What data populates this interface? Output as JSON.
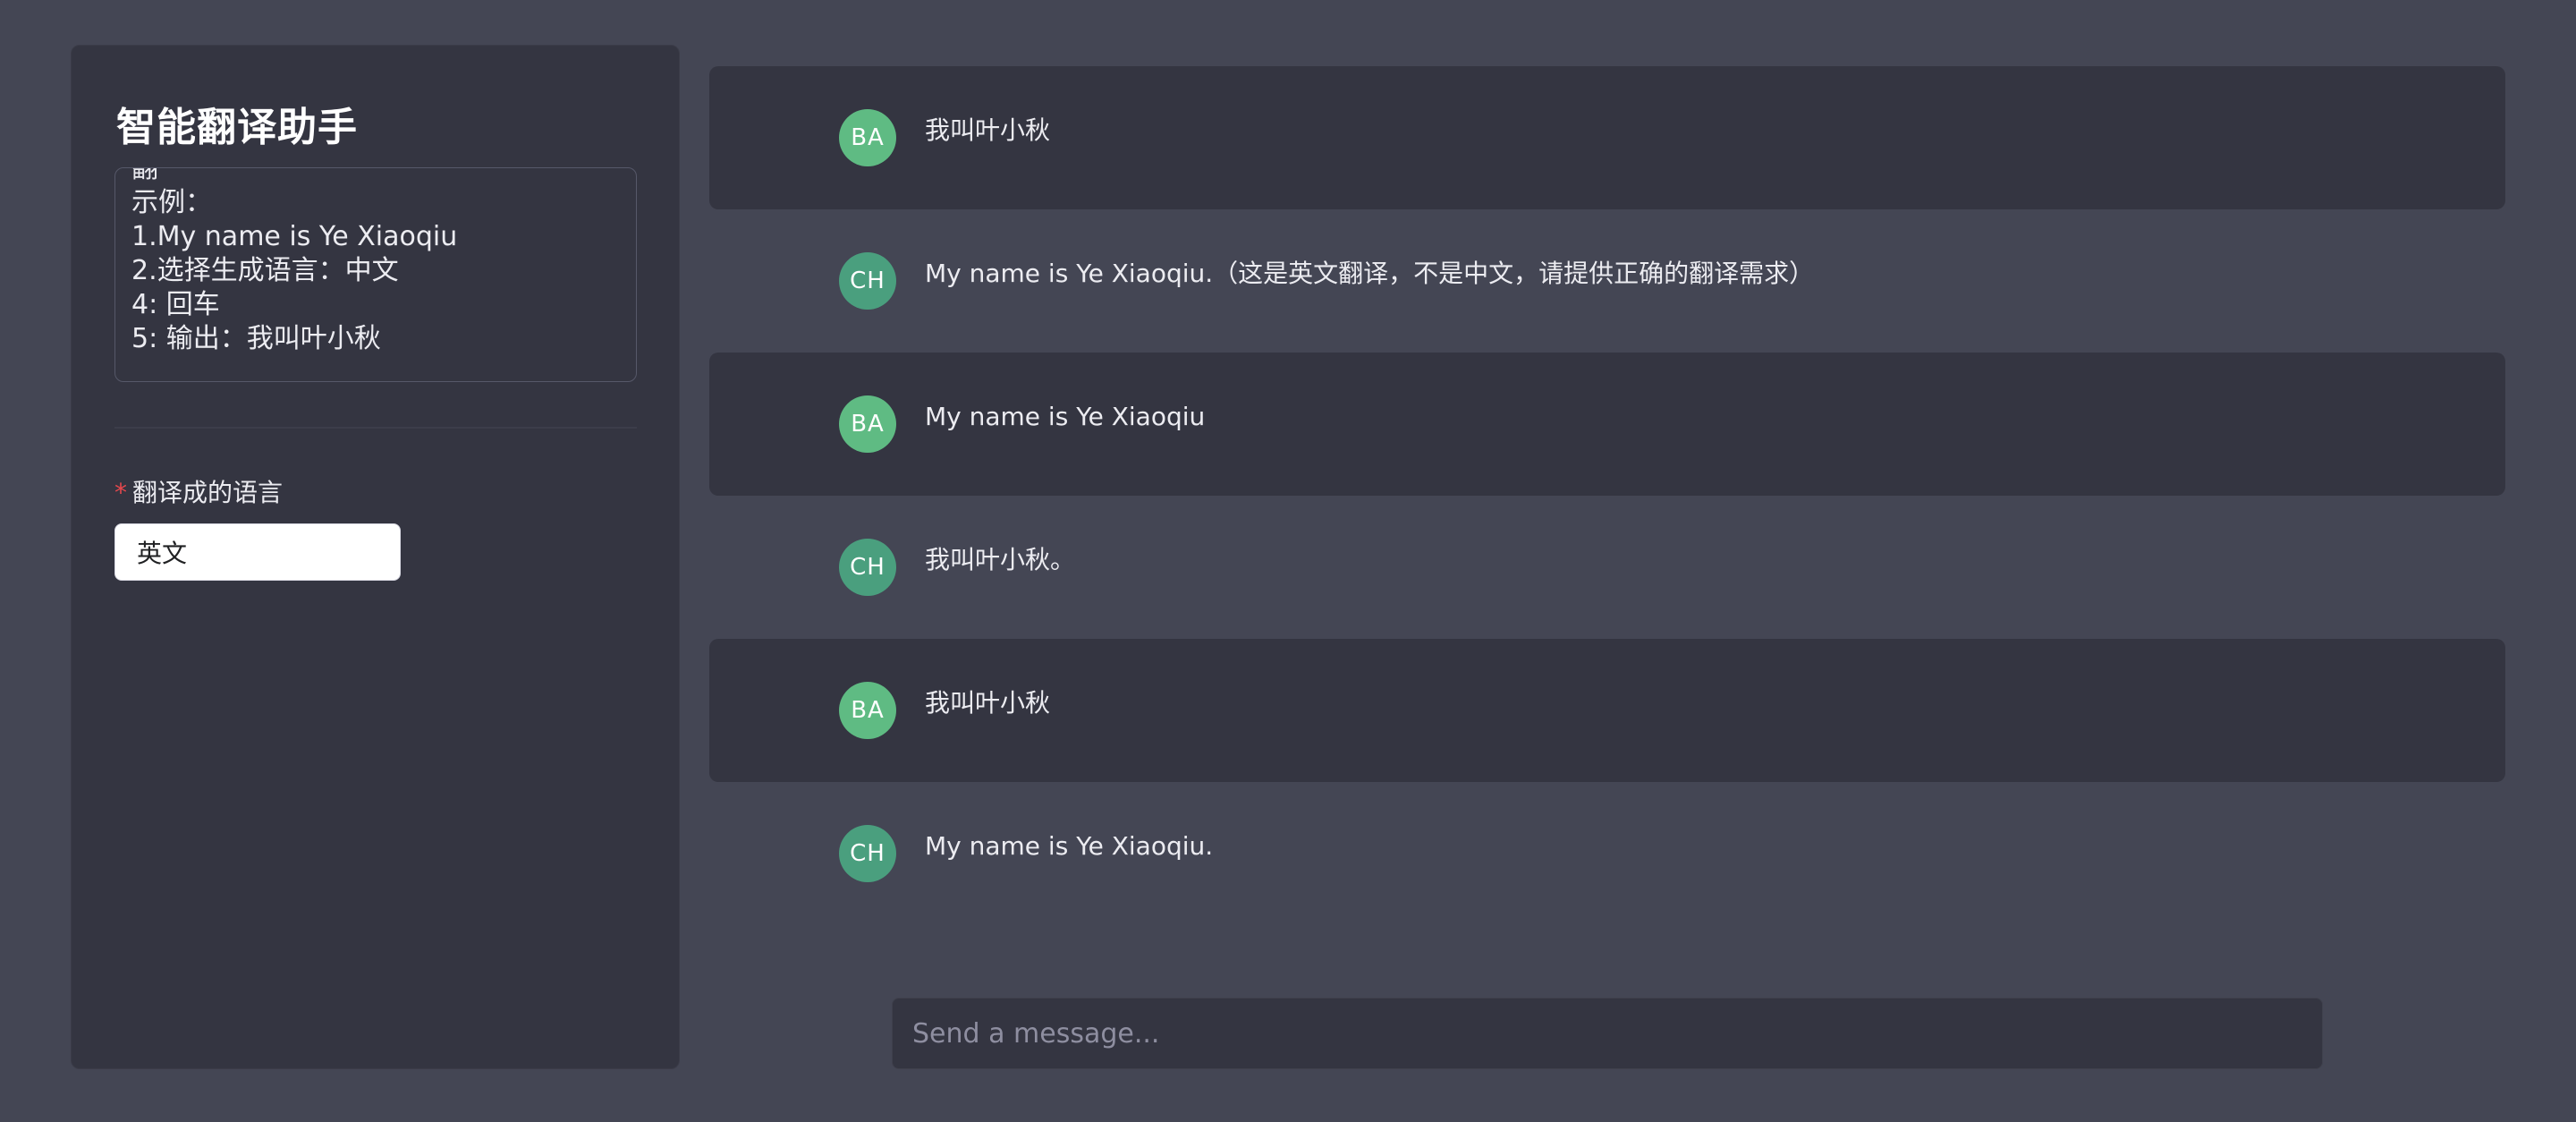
{
  "sidebar": {
    "title": "智能翻译助手",
    "prompt_lines": [
      "翻",
      "示例：",
      "1.My name is Ye Xiaoqiu",
      "2.选择生成语言：中文",
      "4: 回车",
      "5: 输出：我叫叶小秋"
    ],
    "language_field": {
      "required_mark": "*",
      "label": "翻译成的语言",
      "value": "英文"
    }
  },
  "chat": {
    "messages": [
      {
        "role": "user",
        "avatar": "BA",
        "text": "我叫叶小秋"
      },
      {
        "role": "bot",
        "avatar": "CH",
        "text": "My name is Ye Xiaoqiu.（这是英文翻译，不是中文，请提供正确的翻译需求）"
      },
      {
        "role": "user",
        "avatar": "BA",
        "text": "My name is Ye Xiaoqiu"
      },
      {
        "role": "bot",
        "avatar": "CH",
        "text": "我叫叶小秋。"
      },
      {
        "role": "user",
        "avatar": "BA",
        "text": "我叫叶小秋"
      },
      {
        "role": "bot",
        "avatar": "CH",
        "text": "My name is Ye Xiaoqiu."
      }
    ]
  },
  "composer": {
    "placeholder": "Send a message..."
  },
  "colors": {
    "background": "#444654",
    "panel": "#343541",
    "user_avatar": "#5fbb83",
    "bot_avatar": "#4a9f7e",
    "required": "#e5484d"
  }
}
